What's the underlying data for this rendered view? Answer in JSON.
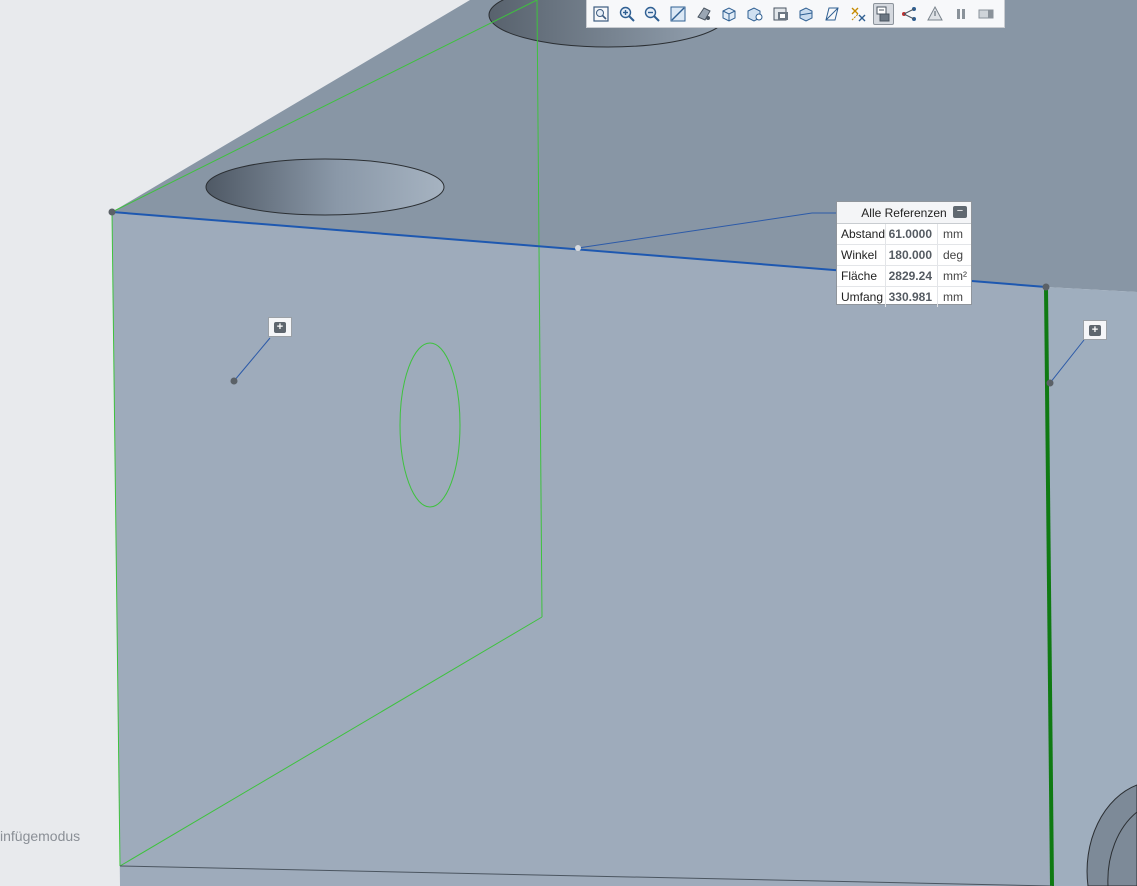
{
  "toolbar": {
    "icons": [
      "zoom-fit-icon",
      "zoom-in-icon",
      "zoom-out-icon",
      "zoom-window-icon",
      "display-style-icon",
      "view-cube-icon",
      "saved-views-icon",
      "view-manager-icon",
      "section-view-icon",
      "datum-display-icon",
      "annotation-display-icon",
      "measure-icon",
      "spin-center-icon",
      "analysis-icon",
      "pause-icon",
      "clear-icon"
    ],
    "active_index": 11
  },
  "measure": {
    "title": "Alle Referenzen",
    "collapse_symbol": "−",
    "rows": [
      {
        "label": "Abstand",
        "value": "61.0000",
        "unit": "mm"
      },
      {
        "label": "Winkel",
        "value": "180.000",
        "unit": "deg"
      },
      {
        "label": "Fläche",
        "value": "2829.24",
        "unit": "mm²"
      },
      {
        "label": "Umfang",
        "value": "330.981",
        "unit": "mm"
      }
    ]
  },
  "annotations": {
    "plus_symbol": "+"
  },
  "status": {
    "mode_text": "infügemodus"
  },
  "colors": {
    "face_front": "#9eabbb",
    "face_top": "#8796a4",
    "edge_highlight": "#1e58b0",
    "edge_green": "#1a9a1a"
  }
}
